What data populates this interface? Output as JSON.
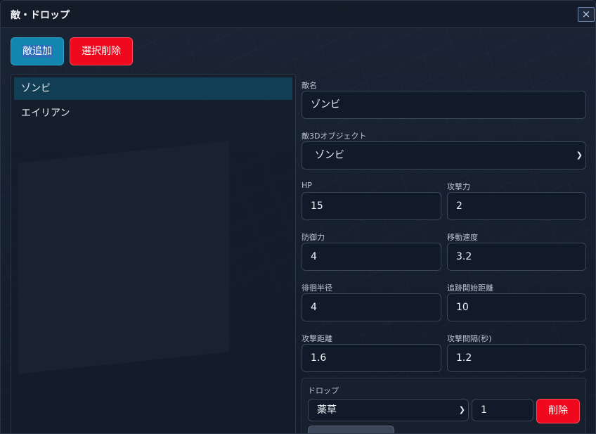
{
  "window": {
    "title": "敵・ドロップ",
    "close_icon": "×"
  },
  "toolbar": {
    "add_label": "敵追加",
    "delete_selected_label": "選択削除"
  },
  "enemy_list": {
    "items": [
      "ゾンビ",
      "エイリアン"
    ],
    "selected_index": 0
  },
  "form": {
    "name_label": "敵名",
    "name_value": "ゾンビ",
    "object_label": "敵3Dオブジェクト",
    "object_value": "ゾンビ",
    "hp_label": "HP",
    "hp_value": "15",
    "attack_label": "攻撃力",
    "attack_value": "2",
    "defense_label": "防御力",
    "defense_value": "4",
    "speed_label": "移動速度",
    "speed_value": "3.2",
    "wander_label": "徘徊半径",
    "wander_value": "4",
    "chase_label": "追跡開始距離",
    "chase_value": "10",
    "attack_range_label": "攻撃距離",
    "attack_range_value": "1.6",
    "attack_interval_label": "攻撃間隔(秒)",
    "attack_interval_value": "1.2"
  },
  "drop": {
    "label": "ドロップ",
    "item_value": "薬草",
    "quantity_value": "1",
    "remove_label": "削除"
  },
  "colors": {
    "accent": "#1386b0",
    "danger": "#f0081e",
    "selected_row": "#113e54"
  }
}
